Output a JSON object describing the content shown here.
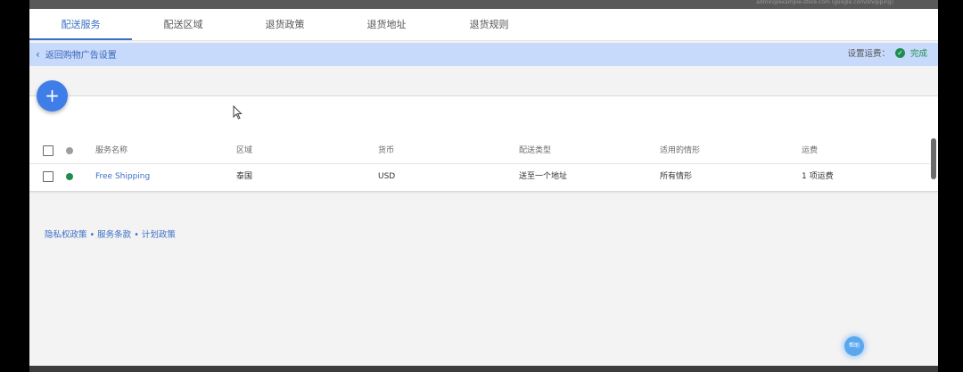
{
  "topbar": {
    "account_text": "admin@example-store.com (google.com/shopping)"
  },
  "tabs": [
    {
      "label": "配送服务",
      "active": true
    },
    {
      "label": "配送区域",
      "active": false
    },
    {
      "label": "退货政策",
      "active": false
    },
    {
      "label": "退货地址",
      "active": false
    },
    {
      "label": "退货规则",
      "active": false
    }
  ],
  "header": {
    "back_label": "返回购物广告设置",
    "status_prefix": "设置运费：",
    "status_done": "完成"
  },
  "fab": {
    "icon": "plus-icon",
    "glyph": "+"
  },
  "table": {
    "columns": [
      "服务名称",
      "区域",
      "货币",
      "配送类型",
      "适用的情形",
      "运费"
    ],
    "rows": [
      {
        "status_color": "#1e8e4e",
        "name": "Free Shipping",
        "region": "泰国",
        "currency": "USD",
        "delivery_type": "送至一个地址",
        "applicable": "所有情形",
        "rate": "1 项运费"
      }
    ],
    "header_dot_color": "#9e9e9e"
  },
  "footer": {
    "links": [
      "隐私权政策",
      "服务条款",
      "计划政策"
    ],
    "separator": " • "
  },
  "help": {
    "label": "帮助"
  },
  "colors": {
    "accent": "#3b6fc4",
    "strip": "#c7dafb",
    "success": "#1e8e4e"
  }
}
